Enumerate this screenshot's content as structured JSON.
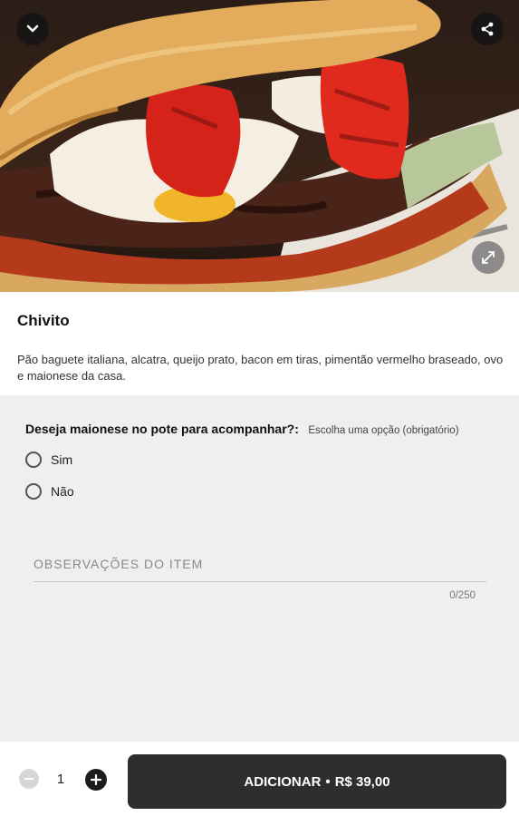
{
  "hero": {
    "back_icon": "chevron-down-icon",
    "share_icon": "share-icon",
    "expand_icon": "expand-icon"
  },
  "product": {
    "name": "Chivito",
    "description": "Pão baguete italiana, alcatra, queijo prato, bacon em tiras, pimentão vermelho braseado, ovo e maionese da casa."
  },
  "question": {
    "title": "Deseja maionese no pote para acompanhar?:",
    "hint": "Escolha uma opção (obrigatório)",
    "options": [
      {
        "label": "Sim"
      },
      {
        "label": "Não"
      }
    ]
  },
  "notes": {
    "placeholder": "OBSERVAÇÕES DO ITEM",
    "counter": "0/250"
  },
  "cart": {
    "quantity": "1",
    "add_label": "ADICIONAR",
    "separator": "•",
    "price": "R$ 39,00"
  },
  "colors": {
    "panel_bg": "#efefef",
    "button_bg": "#2e2e2e"
  }
}
